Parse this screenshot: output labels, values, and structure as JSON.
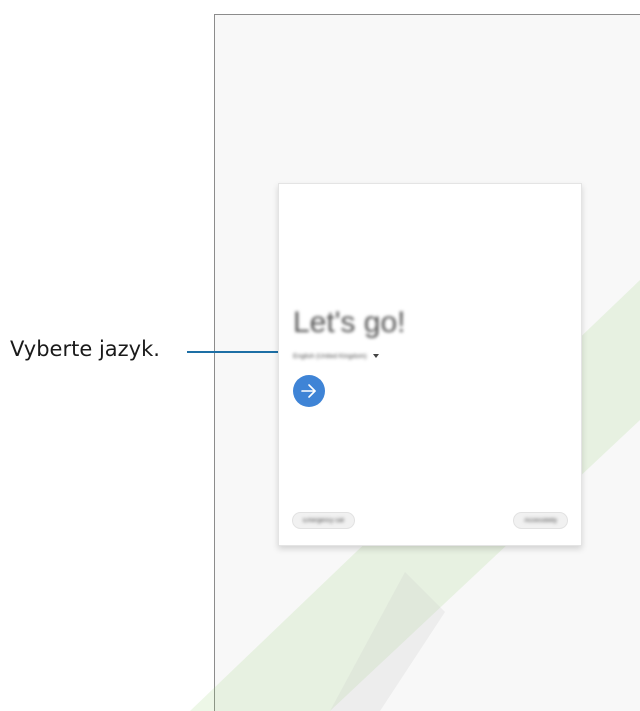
{
  "callout": {
    "label": "Vyberte jazyk."
  },
  "screen": {
    "title": "Let's go!",
    "language_value": "English (United Kingdom)",
    "language_dropdown_icon": "caret-down-icon",
    "next_icon": "arrow-right-icon",
    "emergency_call_label": "Emergency call",
    "accessibility_label": "Accessibility"
  },
  "colors": {
    "callout_line": "#1d6fa5",
    "next_button": "#3f84d6",
    "watermark": "#8fd06a"
  }
}
